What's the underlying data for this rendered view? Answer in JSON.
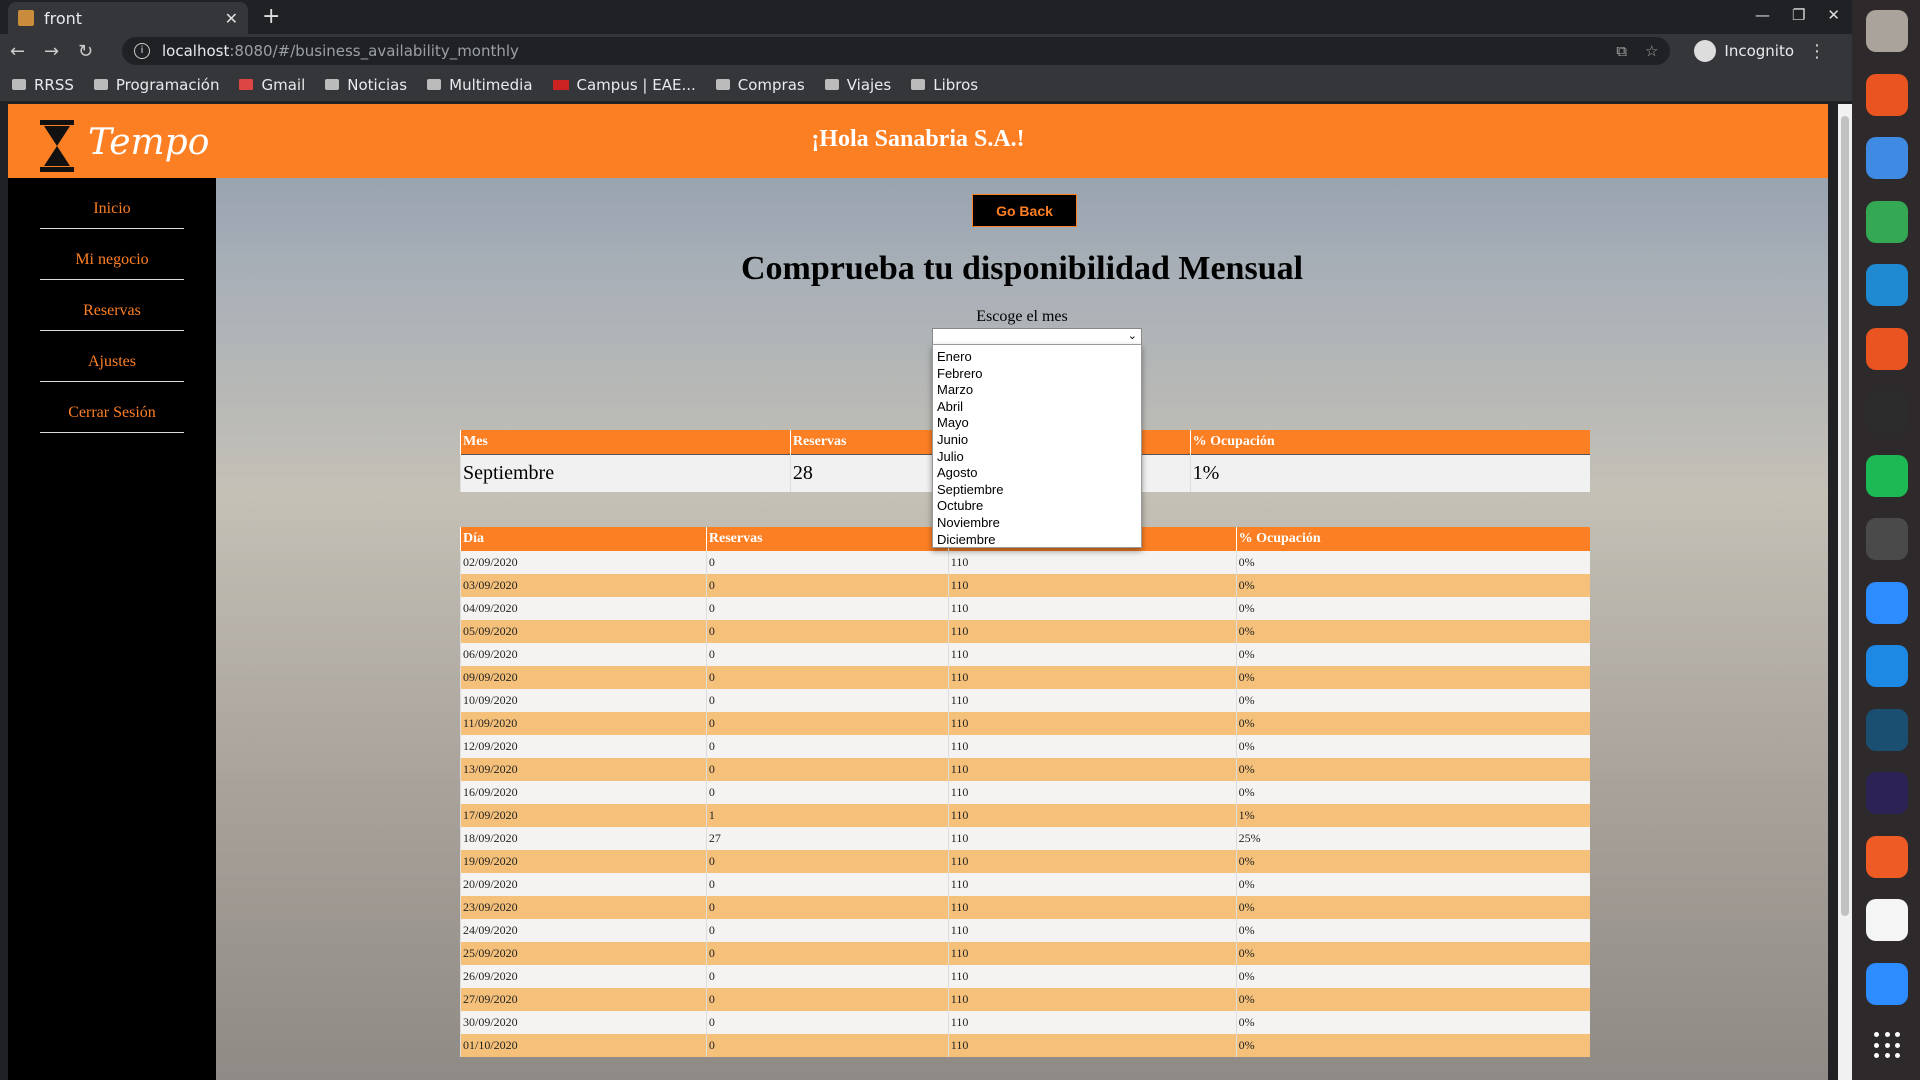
{
  "browser": {
    "tab_title": "front",
    "url_host": "localhost",
    "url_path": ":8080/#/business_availability_monthly",
    "mode_label": "Incognito",
    "bookmarks": [
      "RRSS",
      "Programación",
      "Gmail",
      "Noticias",
      "Multimedia",
      "Campus | EAE...",
      "Compras",
      "Viajes",
      "Libros"
    ]
  },
  "header": {
    "logo_text": "Tempo",
    "greeting": "¡Hola Sanabria S.A.!"
  },
  "sidebar": {
    "items": [
      "Inicio",
      "Mi negocio",
      "Reservas",
      "Ajustes",
      "Cerrar Sesión"
    ]
  },
  "main": {
    "go_back_label": "Go Back",
    "title": "Comprueba tu disponibilidad Mensual",
    "month_label": "Escoge el mes",
    "month_selected": "",
    "month_options": [
      "Enero",
      "Febrero",
      "Marzo",
      "Abril",
      "Mayo",
      "Junio",
      "Julio",
      "Agosto",
      "Septiembre",
      "Octubre",
      "Noviembre",
      "Diciembre"
    ]
  },
  "summary_table": {
    "headers": [
      "Mes",
      "Reservas",
      "",
      "% Ocupación"
    ],
    "row": [
      "Septiembre",
      "28",
      "",
      "1%"
    ]
  },
  "daily_table": {
    "headers": [
      "Día",
      "Reservas",
      "",
      "% Ocupación"
    ],
    "rows": [
      [
        "02/09/2020",
        "0",
        "110",
        "0%"
      ],
      [
        "03/09/2020",
        "0",
        "110",
        "0%"
      ],
      [
        "04/09/2020",
        "0",
        "110",
        "0%"
      ],
      [
        "05/09/2020",
        "0",
        "110",
        "0%"
      ],
      [
        "06/09/2020",
        "0",
        "110",
        "0%"
      ],
      [
        "09/09/2020",
        "0",
        "110",
        "0%"
      ],
      [
        "10/09/2020",
        "0",
        "110",
        "0%"
      ],
      [
        "11/09/2020",
        "0",
        "110",
        "0%"
      ],
      [
        "12/09/2020",
        "0",
        "110",
        "0%"
      ],
      [
        "13/09/2020",
        "0",
        "110",
        "0%"
      ],
      [
        "16/09/2020",
        "0",
        "110",
        "0%"
      ],
      [
        "17/09/2020",
        "1",
        "110",
        "1%"
      ],
      [
        "18/09/2020",
        "27",
        "110",
        "25%"
      ],
      [
        "19/09/2020",
        "0",
        "110",
        "0%"
      ],
      [
        "20/09/2020",
        "0",
        "110",
        "0%"
      ],
      [
        "23/09/2020",
        "0",
        "110",
        "0%"
      ],
      [
        "24/09/2020",
        "0",
        "110",
        "0%"
      ],
      [
        "25/09/2020",
        "0",
        "110",
        "0%"
      ],
      [
        "26/09/2020",
        "0",
        "110",
        "0%"
      ],
      [
        "27/09/2020",
        "0",
        "110",
        "0%"
      ],
      [
        "30/09/2020",
        "0",
        "110",
        "0%"
      ],
      [
        "01/10/2020",
        "0",
        "110",
        "0%"
      ]
    ]
  },
  "dock": {
    "apps": [
      {
        "icon": "files-icon",
        "color": "#a9a39b"
      },
      {
        "icon": "software-center-icon",
        "color": "#e95420"
      },
      {
        "icon": "help-icon",
        "color": "#3f8ae2"
      },
      {
        "icon": "chrome-icon",
        "color": "#34a853"
      },
      {
        "icon": "vscode-icon",
        "color": "#1f8ad2"
      },
      {
        "icon": "ubuntu-icon",
        "color": "#e95420"
      },
      {
        "icon": "terminal-icon",
        "color": "#2c2c2c"
      },
      {
        "icon": "spotify-icon",
        "color": "#1db954"
      },
      {
        "icon": "calculator-icon",
        "color": "#4a4a4a"
      },
      {
        "icon": "zoom-icon",
        "color": "#2d8cff"
      },
      {
        "icon": "remote-desktop-icon",
        "color": "#1e88e5"
      },
      {
        "icon": "mysql-workbench-icon",
        "color": "#1b4f72"
      },
      {
        "icon": "eclipse-icon",
        "color": "#2c2255"
      },
      {
        "icon": "postman-icon",
        "color": "#ef5b25"
      },
      {
        "icon": "notes-icon",
        "color": "#f5f5f5"
      },
      {
        "icon": "zoom-meeting-icon",
        "color": "#2d8cff"
      }
    ]
  }
}
